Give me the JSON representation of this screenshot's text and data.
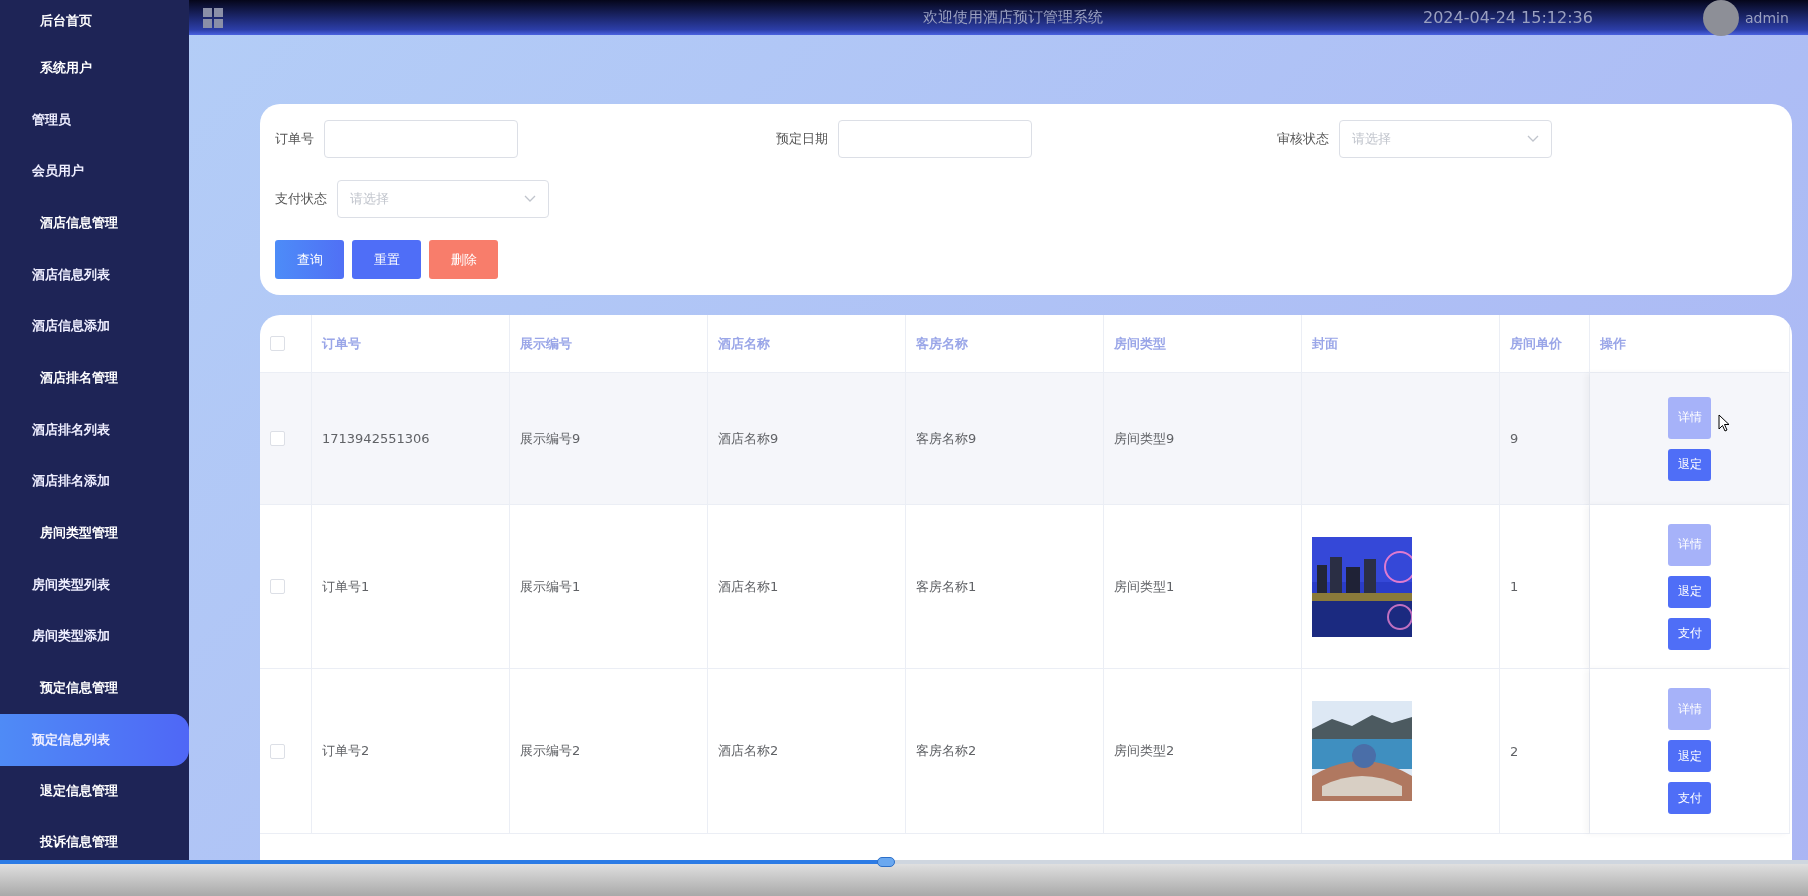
{
  "header": {
    "title": "欢迎使用酒店预订管理系统",
    "datetime": "2024-04-24 15:12:36",
    "user": "admin"
  },
  "sidebar": {
    "items": [
      {
        "label": "后台首页",
        "kind": "group",
        "selected": false
      },
      {
        "label": "系统用户",
        "kind": "group",
        "selected": false
      },
      {
        "label": "管理员",
        "kind": "sub",
        "selected": false
      },
      {
        "label": "会员用户",
        "kind": "sub",
        "selected": false
      },
      {
        "label": "酒店信息管理",
        "kind": "group",
        "selected": false
      },
      {
        "label": "酒店信息列表",
        "kind": "sub",
        "selected": false
      },
      {
        "label": "酒店信息添加",
        "kind": "sub",
        "selected": false
      },
      {
        "label": "酒店排名管理",
        "kind": "group",
        "selected": false
      },
      {
        "label": "酒店排名列表",
        "kind": "sub",
        "selected": false
      },
      {
        "label": "酒店排名添加",
        "kind": "sub",
        "selected": false
      },
      {
        "label": "房间类型管理",
        "kind": "group",
        "selected": false
      },
      {
        "label": "房间类型列表",
        "kind": "sub",
        "selected": false
      },
      {
        "label": "房间类型添加",
        "kind": "sub",
        "selected": false
      },
      {
        "label": "预定信息管理",
        "kind": "group",
        "selected": false
      },
      {
        "label": "预定信息列表",
        "kind": "sub",
        "selected": true
      },
      {
        "label": "退定信息管理",
        "kind": "group",
        "selected": false
      },
      {
        "label": "投诉信息管理",
        "kind": "group",
        "selected": false
      }
    ]
  },
  "filters": [
    {
      "label": "订单号",
      "kind": "input"
    },
    {
      "label": "预定日期",
      "kind": "input"
    },
    {
      "label": "审核状态",
      "kind": "select",
      "placeholder": "请选择"
    },
    {
      "label": "支付状态",
      "kind": "select",
      "placeholder": "请选择"
    }
  ],
  "filter_buttons": [
    {
      "label": "查询",
      "kind": "search"
    },
    {
      "label": "重置",
      "kind": "reset"
    },
    {
      "label": "删除",
      "kind": "delete"
    }
  ],
  "table": {
    "all_checked": false,
    "columns": [
      "订单号",
      "展示编号",
      "酒店名称",
      "客房名称",
      "房间类型",
      "封面",
      "房间单价",
      "操作"
    ],
    "rows": [
      {
        "checked": false,
        "cells": [
          "1713942551306",
          "展示编号9",
          "酒店名称9",
          "客房名称9",
          "房间类型9"
        ],
        "price": "9",
        "actions": [
          {
            "label": "详情",
            "kind": "detail"
          },
          {
            "label": "退定",
            "kind": "primary"
          }
        ]
      },
      {
        "checked": false,
        "cells": [
          "订单号1",
          "展示编号1",
          "酒店名称1",
          "客房名称1",
          "房间类型1"
        ],
        "cover": {
          "kind": "picture"
        },
        "price": "1",
        "actions": [
          {
            "label": "详情",
            "kind": "detail"
          },
          {
            "label": "退定",
            "kind": "primary"
          },
          {
            "label": "支付",
            "kind": "primary"
          }
        ]
      },
      {
        "checked": false,
        "cells": [
          "订单号2",
          "展示编号2",
          "酒店名称2",
          "客房名称2",
          "房间类型2"
        ],
        "cover": {
          "kind": "picture"
        },
        "price": "2",
        "actions": [
          {
            "label": "详情",
            "kind": "detail"
          },
          {
            "label": "退定",
            "kind": "primary"
          },
          {
            "label": "支付",
            "kind": "primary"
          }
        ]
      }
    ]
  },
  "player": {
    "level": 0.49
  }
}
